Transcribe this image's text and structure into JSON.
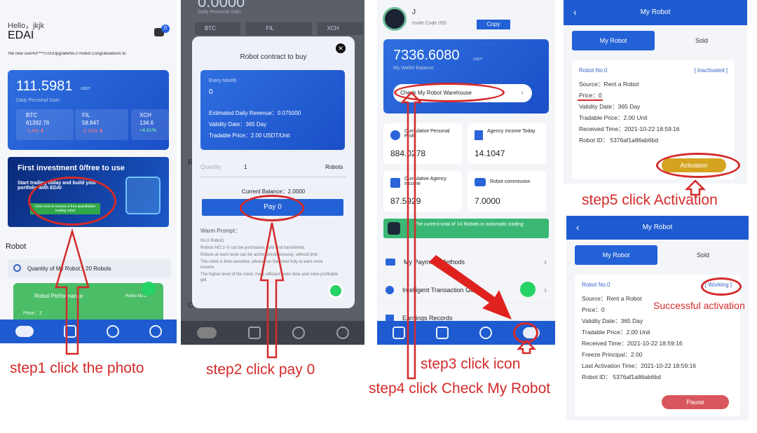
{
  "p1": {
    "greeting": "Hello，jkjk",
    "app": "EDAI",
    "badge": "0",
    "ticker": "the new user43****0750UpgradeNo.0 Robot Congratulations to",
    "gain_value": "111.5981",
    "gain_unit": "USDT",
    "gain_label": "Daily Personal Gain",
    "coins": [
      {
        "name": "BTC",
        "price": "61392.76",
        "change": "-1.4% ⬇"
      },
      {
        "name": "FIL",
        "price": "58.847",
        "change": "-2.15% ⬇"
      },
      {
        "name": "XCH",
        "price": "134.6",
        "change": "+4.41%"
      }
    ],
    "banner_title": "First investment 0/free to use",
    "banner_sub": "Start trading today and build your portfolio with EDAI",
    "banner_btn": "Click here to receive a free quantitative trading robot",
    "section_robot": "Robot",
    "qty_label": "Quantity of My Robot：20 Robots",
    "perf_label": "Robot Performance",
    "perf_price": "Price：2",
    "perf_tag": "Robot No.1"
  },
  "p2": {
    "header_val": "0.0000",
    "header_sub": "Daily Personal Gain",
    "tabs": [
      "BTC",
      "FIL",
      "XCH"
    ],
    "modal_title": "Robot contract to buy",
    "every_month": "Every Month",
    "month_val": "0",
    "est": "Estimated Daily Revenue：0.075000",
    "validity": "Validity Date：365 Day",
    "tradable": "Tradable Price：2.00 USDT/Unit",
    "qty_label": "Quantity",
    "qty_val": "1",
    "qty_unit": "Robots",
    "balance": "Current Balance：2.0000",
    "pay": "Pay 0",
    "warm_title": "Warm Prompt：",
    "warm": [
      "No.0 Robot1",
      "Robots NO.1~5 can be purchased, sold and transferred.",
      "Robots at each level can be active simultaneously, without limit",
      "The robot is time-sensitive, please run the robot fully to earn more income.",
      "The higher level of the robot, more efficient order time and more profitable get."
    ],
    "side_letter1": "R",
    "side_letter2": "C"
  },
  "p3": {
    "user": "J",
    "invite": "Invite Code  055",
    "copy": "Copy",
    "wallet": "7336.6080",
    "wallet_unit": "USDT",
    "wallet_label": "My Wallet Balance",
    "check": "Check My Robot Warehouse",
    "stats": [
      {
        "label": "Cumulative Personal Profit",
        "value": "884.0278"
      },
      {
        "label": "Agency Income Today",
        "value": "14.1047"
      },
      {
        "label": "Cumulative Agency Income",
        "value": "87.5929"
      },
      {
        "label": "Robot commission",
        "value": "7.0000"
      }
    ],
    "robots_banner": "The current total of 14 Robots in automatic trading",
    "menu": [
      "My Payment Methods",
      "Intelligent Transaction Guide",
      "Earnings Records"
    ]
  },
  "p4": {
    "title": "My Robot",
    "tab1": "My Robot",
    "tab2": "Sold",
    "robot_no": "Robot No.0",
    "status1": "[ Inactivated ]",
    "source": "Source：Rent a Robot",
    "price": "Price：0",
    "validity": "Validity Date：365 Day",
    "tradable": "Tradable Price：2.00 Unit",
    "received": "Received Time：2021-10-22 18:59:16",
    "robot_id": "Robot ID：  5376af1a86ab6bd",
    "activation": "Activation",
    "status2": "[ Working ]",
    "freeze": "Freeze Principal：2.00",
    "last": "Last Activation Time：2021-10-22 18:59:16",
    "pause": "Pause"
  },
  "steps": {
    "s1": "step1 click  the photo",
    "s2": "step2 click pay 0",
    "s3": "step3 click  icon",
    "s4": "step4 click Check My Robot",
    "s5": "step5 click Activation",
    "s6": "Successful activation"
  },
  "colors": {
    "blue": "#1f5fd6",
    "red": "#d42a2a",
    "green": "#2fb86a",
    "gold": "#d4a320"
  }
}
